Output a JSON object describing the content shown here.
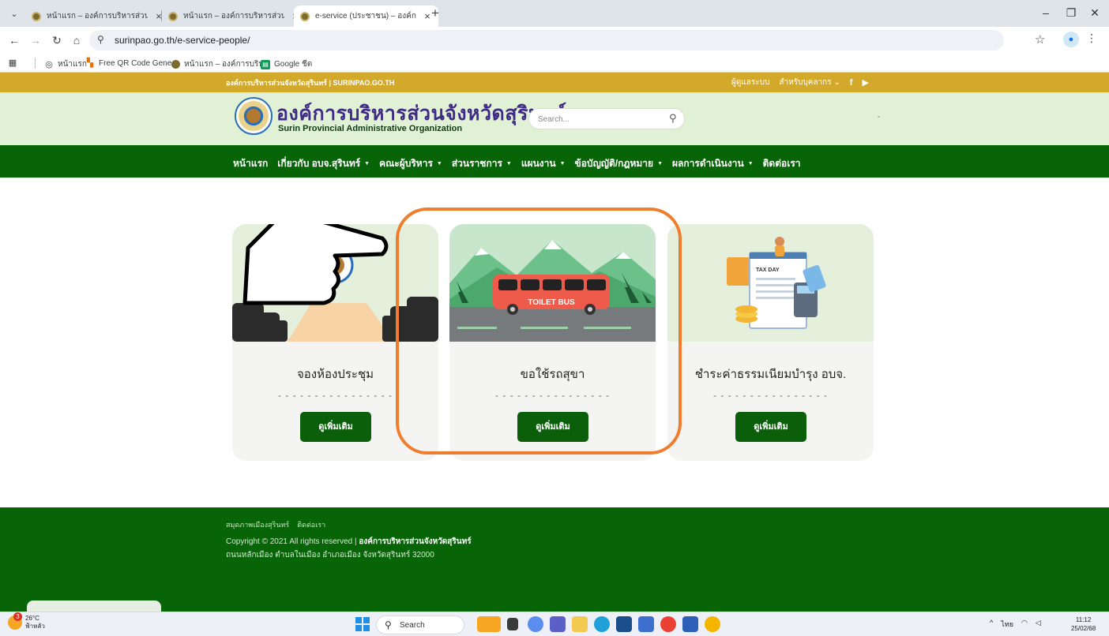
{
  "browser": {
    "tabs": [
      {
        "title": "หน้าแรก – องค์การบริหารส่วนจังหวัด",
        "active": false
      },
      {
        "title": "หน้าแรก – องค์การบริหารส่วนจังหวัด",
        "active": false
      },
      {
        "title": "e-service (ประชาชน) – องค์การบริห",
        "active": true
      }
    ],
    "url": "surinpao.go.th/e-service-people/",
    "bookmarks": [
      {
        "label": "หน้าแรก"
      },
      {
        "label": "Free QR Code Gene..."
      },
      {
        "label": "หน้าแรก – องค์การบริห..."
      },
      {
        "label": "Google ชีต"
      }
    ]
  },
  "site": {
    "topbar_left": "องค์การบริหารส่วนจังหวัดสุรินทร์ | SURINPAO.GO.TH",
    "topbar_links": [
      "ผู้ดูแลระบบ",
      "สำหรับบุคลากร"
    ],
    "logo_th": "องค์การบริหารส่วนจังหวัดสุรินทร์",
    "logo_en": "Surin Provincial Administrative Organization",
    "search_placeholder": "Search...",
    "header_dash": "-",
    "nav": [
      {
        "label": "หน้าแรก",
        "has_caret": false
      },
      {
        "label": "เกี่ยวกับ อบจ.สุรินทร์",
        "has_caret": true
      },
      {
        "label": "คณะผู้บริหาร",
        "has_caret": true
      },
      {
        "label": "ส่วนราชการ",
        "has_caret": true
      },
      {
        "label": "แผนงาน",
        "has_caret": true
      },
      {
        "label": "ข้อบัญญัติ/กฎหมาย",
        "has_caret": true
      },
      {
        "label": "ผลการดำเนินงาน",
        "has_caret": true
      },
      {
        "label": "ติดต่อเรา",
        "has_caret": false
      }
    ],
    "cards": [
      {
        "title": "จองห้องประชุม",
        "dashes": "- - - - - - - - - - - - - - - -",
        "button": "ดูเพิ่มเติม"
      },
      {
        "title": "ขอใช้รถสุขา",
        "dashes": "- - - - - - - - - - - - - - - -",
        "button": "ดูเพิ่มเติม",
        "image_text": "TOILET BUS",
        "highlighted": true
      },
      {
        "title": "ชำระค่าธรรมเนียมบำรุง อบจ.",
        "dashes": "- - - - - - - - - - - - - - - -",
        "button": "ดูเพิ่มเติม",
        "image_text": "TAX DAY"
      }
    ],
    "footer": {
      "links": [
        "สมุดภาพเมืองสุรินทร์",
        "ติดต่อเรา"
      ],
      "copyright": "Copyright © 2021 All rights reserved |",
      "copyright_org": "องค์การบริหารส่วนจังหวัดสุรินทร์",
      "address": "ถนนหลักเมือง ตำบลในเมือง อำเภอเมือง จังหวัดสุรินทร์ 32000"
    }
  },
  "taskbar": {
    "weather_temp": "26°C",
    "weather_desc": "ฟ้าหลัว",
    "weather_badge": "3",
    "search_label": "Search",
    "tray_lang": "ไทย",
    "time": "11:12",
    "date": "25/02/68"
  },
  "colors": {
    "topbar": "#d3a92b",
    "header": "#e0f1d6",
    "nav": "#086507",
    "button": "#0b5f0b",
    "highlight": "#f07d2e"
  }
}
